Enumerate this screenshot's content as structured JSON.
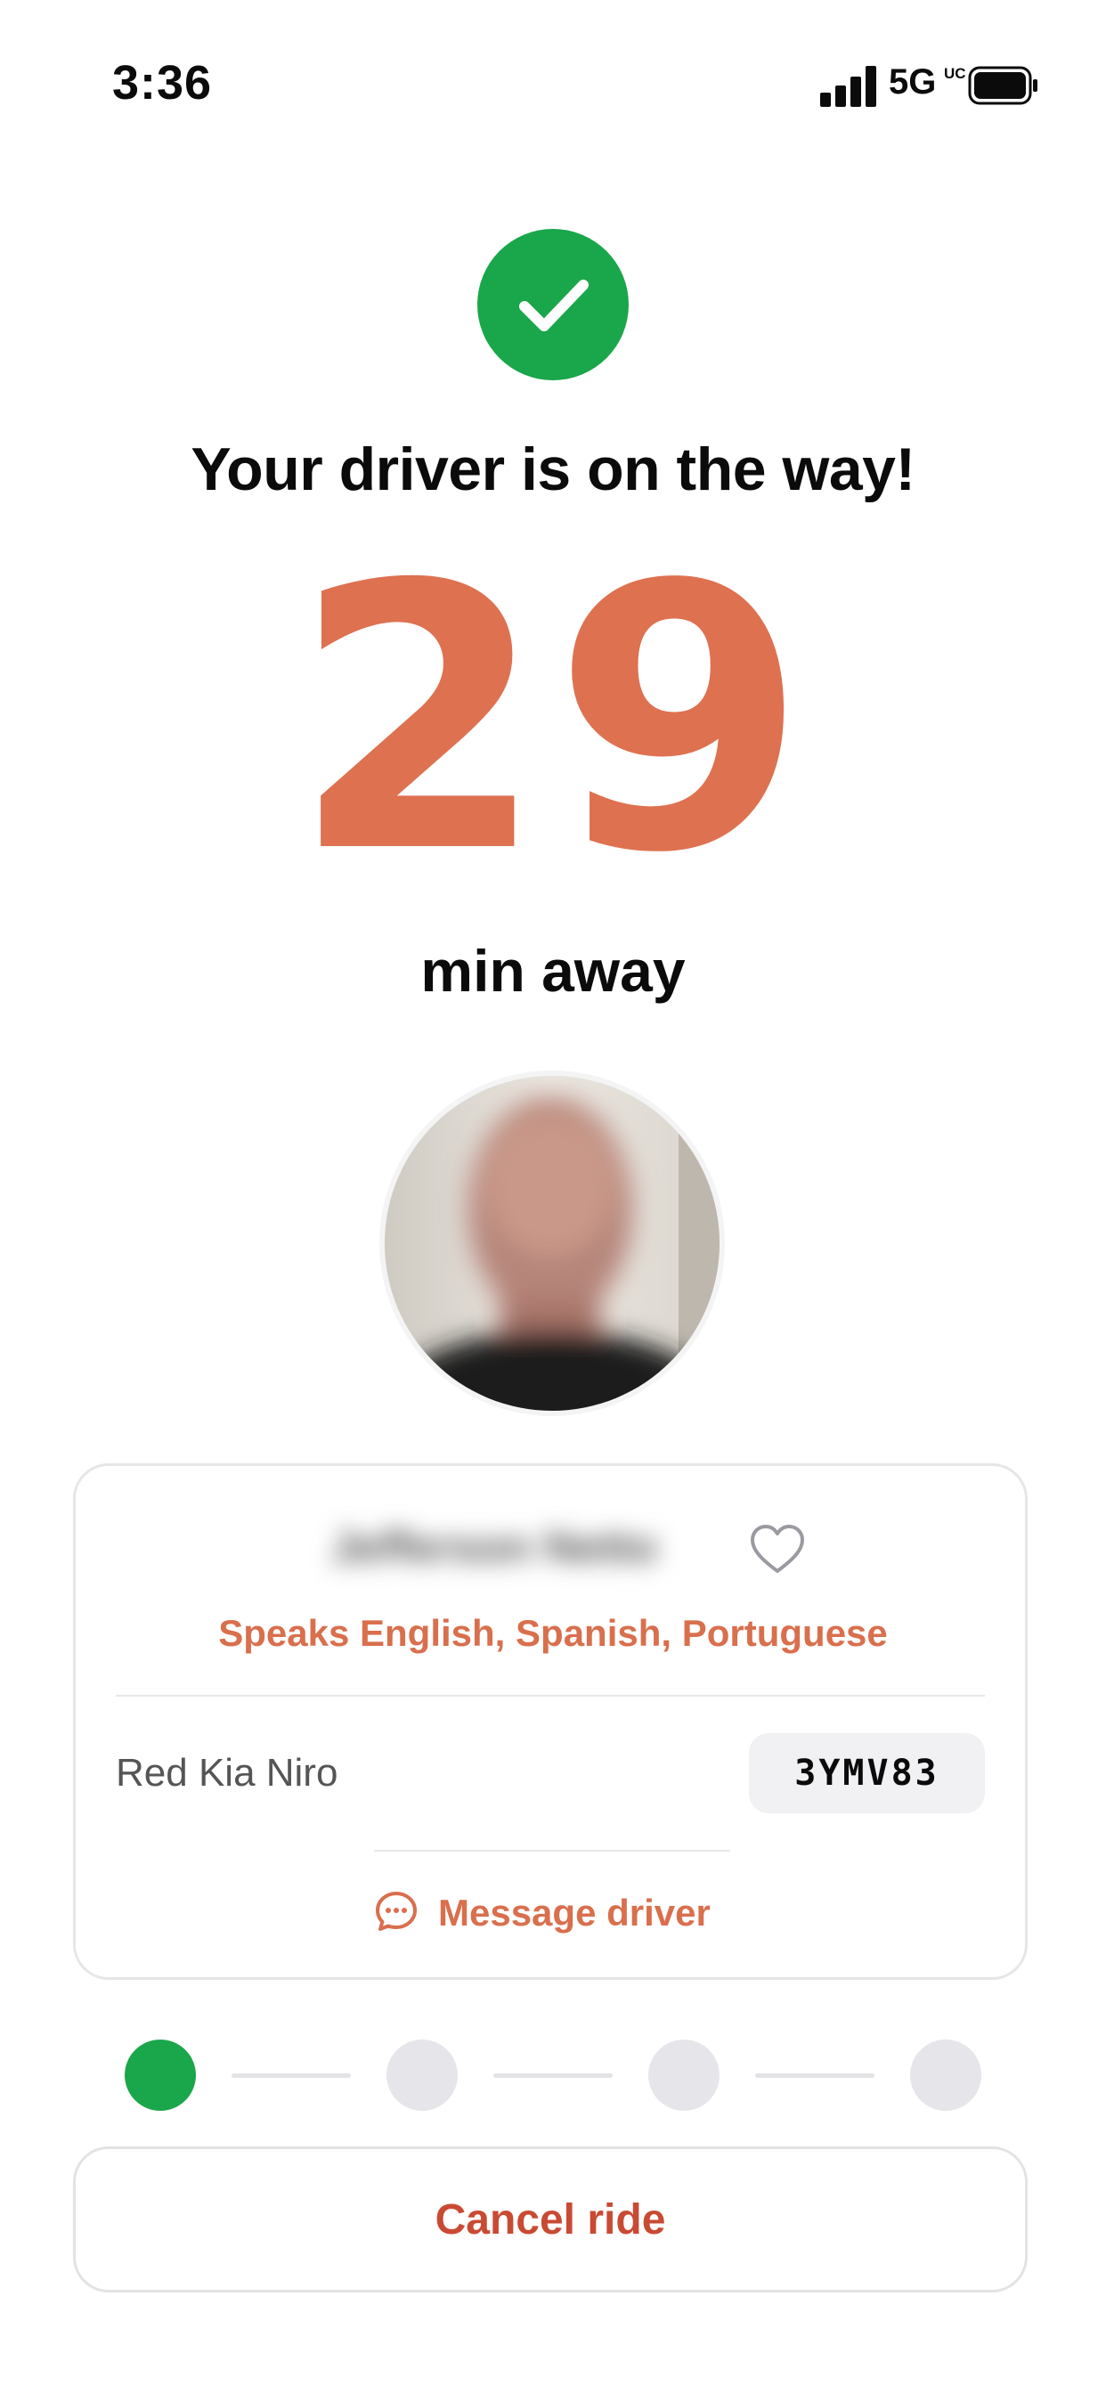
{
  "status_bar": {
    "time": "3:36",
    "network": "5G",
    "network_sup": "UC",
    "signal_icon": "cellular-signal-icon",
    "battery_icon": "battery-icon"
  },
  "confirmation": {
    "icon": "checkmark-icon",
    "headline": "Your driver is on the way!",
    "eta_minutes": "29",
    "eta_unit": "min away"
  },
  "driver": {
    "name": "Jefferson Netto",
    "languages": "Speaks English, Spanish, Portuguese",
    "favorite_icon": "heart-icon",
    "vehicle": "Red Kia Niro",
    "plate": "3YMV83",
    "message_label": "Message driver",
    "message_icon": "chat-bubble-icon"
  },
  "progress": {
    "total_steps": 4,
    "current_step": 1
  },
  "actions": {
    "cancel_label": "Cancel ride"
  },
  "colors": {
    "accent": "#de7150",
    "success": "#1aa64a",
    "danger": "#c94a33"
  }
}
